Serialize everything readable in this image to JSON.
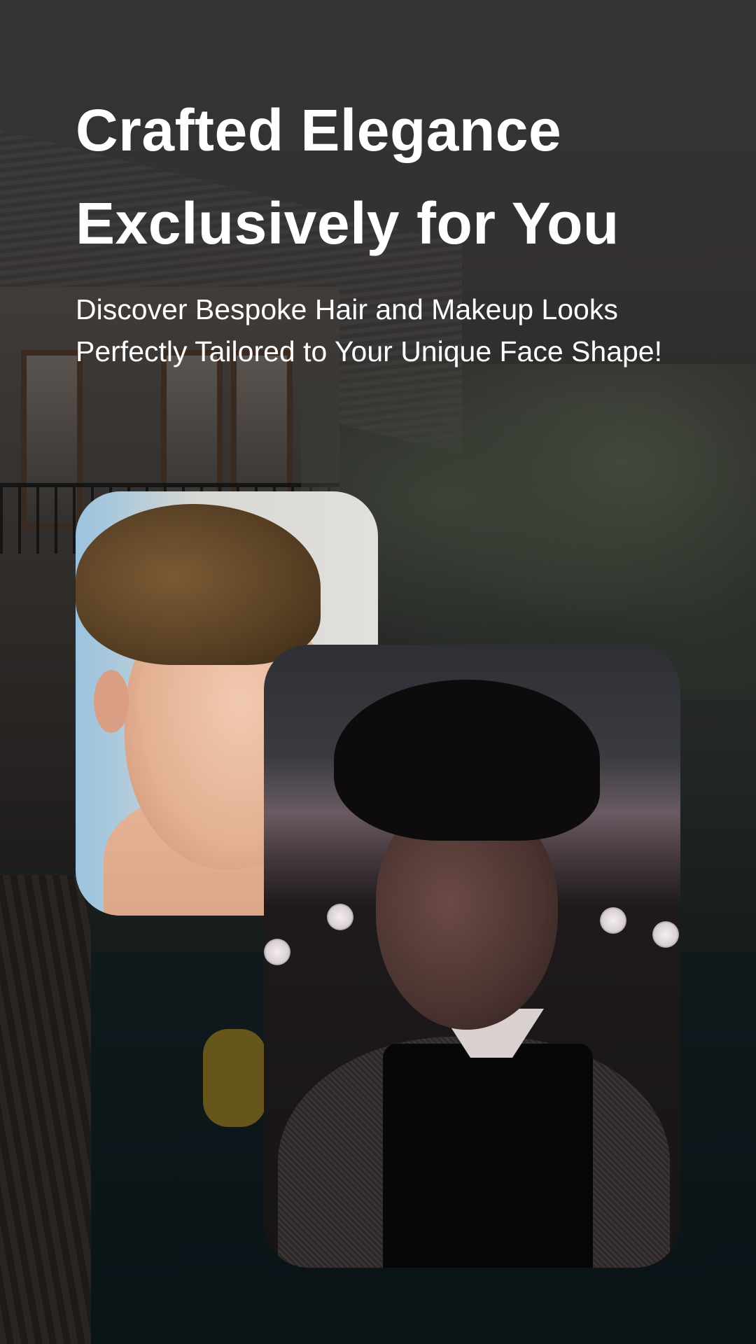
{
  "hero": {
    "title_line_1": "Crafted Elegance",
    "title_line_2": "Exclusively for You",
    "subtitle": "Discover Bespoke Hair and Makeup Looks Perfectly Tailored to Your Unique Face Shape!"
  },
  "colors": {
    "background": "#2f2c2c",
    "text": "#ffffff"
  }
}
